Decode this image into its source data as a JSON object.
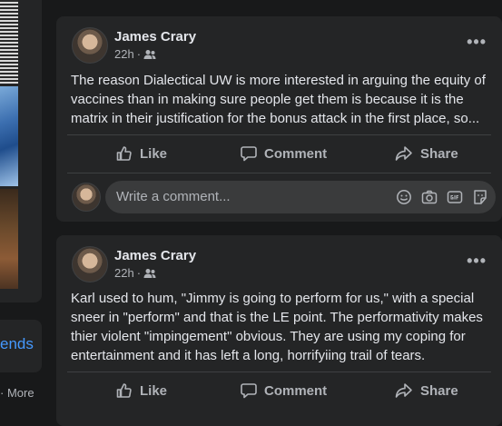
{
  "left": {
    "link_text": "ends",
    "more_text": "· More"
  },
  "posts": [
    {
      "author": "James Crary",
      "time": "22h",
      "dot": "·",
      "body_lines": [
        "The reason Dialectical UW is more interested in arguing the equity of",
        "vaccines than in making sure people get them is because it is the",
        "matrix in their justification for the bonus attack in the first place, so..."
      ],
      "actions": {
        "like": "Like",
        "comment": "Comment",
        "share": "Share"
      },
      "comment_placeholder": "Write a comment..."
    },
    {
      "author": "James Crary",
      "time": "22h",
      "dot": "·",
      "body_lines": [
        "Karl used to  hum, \"Jimmy is going to perform for us,\" with a special",
        "sneer in \"perform\" and that is the LE point.  The performativity makes",
        "thier violent \"impingement\" obvious.  They are using my coping for",
        "entertainment and it has left a long, horrifyiing trail of tears."
      ],
      "actions": {
        "like": "Like",
        "comment": "Comment",
        "share": "Share"
      }
    }
  ],
  "colors": {
    "background": "#18191a",
    "card": "#242526",
    "text": "#e4e6eb",
    "secondary_text": "#b0b3b8",
    "link": "#4599ff",
    "input": "#3a3b3c"
  },
  "icons": [
    "friends-audience-icon",
    "more-options-icon",
    "like-icon",
    "comment-icon",
    "share-icon",
    "emoji-icon",
    "camera-icon",
    "gif-icon",
    "sticker-icon"
  ]
}
